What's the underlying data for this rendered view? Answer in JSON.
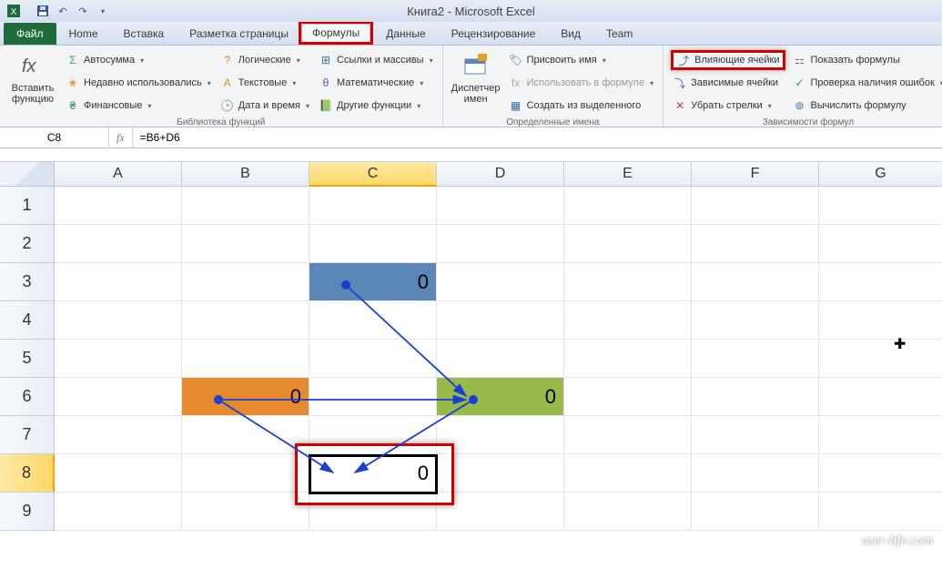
{
  "title": "Книга2 - Microsoft Excel",
  "file_tab": "Файл",
  "tabs": [
    "Home",
    "Вставка",
    "Разметка страницы",
    "Формулы",
    "Данные",
    "Рецензирование",
    "Вид",
    "Team"
  ],
  "active_tab_index": 3,
  "ribbon": {
    "insert_fn": {
      "line1": "Вставить",
      "line2": "функцию"
    },
    "lib": {
      "autosum": "Автосумма",
      "recent": "Недавно использовались",
      "financial": "Финансовые",
      "logical": "Логические",
      "text": "Текстовые",
      "datetime": "Дата и время",
      "lookup": "Ссылки и массивы",
      "math": "Математические",
      "other": "Другие функции",
      "label": "Библиотека функций"
    },
    "name_mgr": {
      "line1": "Диспетчер",
      "line2": "имен"
    },
    "names": {
      "define": "Присвоить имя",
      "use": "Использовать в формуле",
      "create": "Создать из выделенного",
      "label": "Определенные имена"
    },
    "audit": {
      "precedents": "Влияющие ячейки",
      "dependents": "Зависимые ячейки",
      "remove_arrows": "Убрать стрелки",
      "show_formulas": "Показать формулы",
      "error_check": "Проверка наличия ошибок",
      "evaluate": "Вычислить формулу",
      "label": "Зависимости формул"
    }
  },
  "namebox": "C8",
  "formula": "=B6+D6",
  "columns": [
    "A",
    "B",
    "C",
    "D",
    "E",
    "F",
    "G"
  ],
  "rows": [
    "1",
    "2",
    "3",
    "4",
    "5",
    "6",
    "7",
    "8",
    "9"
  ],
  "cells": {
    "C3": "0",
    "B6": "0",
    "D6": "0",
    "C8": "0"
  },
  "cell_colors": {
    "C3": "#5a87b6",
    "B6": "#e58a2e",
    "D6": "#9ab94b"
  },
  "watermark": "user-life.com"
}
